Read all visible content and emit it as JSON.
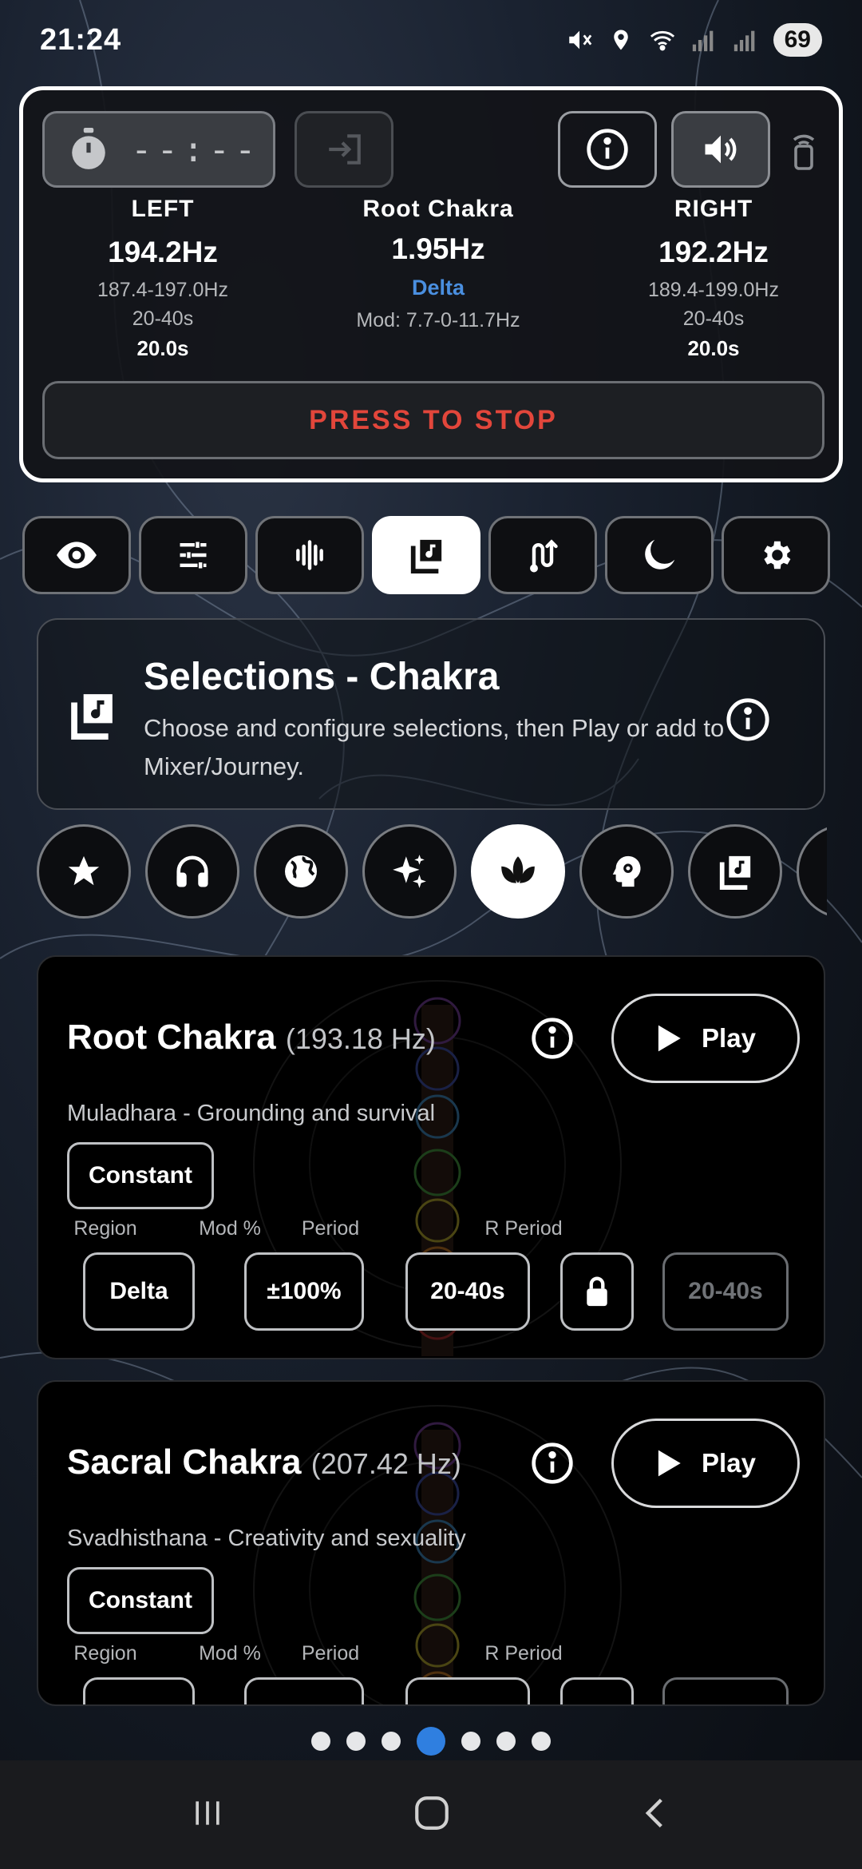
{
  "status_bar": {
    "time": "21:24",
    "battery": "69",
    "icons": [
      "mute-icon",
      "location-icon",
      "wifi-icon",
      "signal-icon",
      "signal-icon"
    ]
  },
  "player": {
    "timer": "--:--",
    "left": {
      "label": "LEFT",
      "hz": "194.2Hz",
      "range": "187.4-197.0Hz",
      "period": "20-40s",
      "current": "20.0s"
    },
    "center": {
      "name": "Root Chakra",
      "hz": "1.95Hz",
      "region": "Delta",
      "mod": "Mod: 7.7-0-11.7Hz"
    },
    "right": {
      "label": "RIGHT",
      "hz": "192.2Hz",
      "range": "189.4-199.0Hz",
      "period": "20-40s",
      "current": "20.0s"
    },
    "stop_label": "PRESS TO STOP"
  },
  "tabs": [
    {
      "icon": "eye-icon"
    },
    {
      "icon": "sliders-icon"
    },
    {
      "icon": "waveform-icon"
    },
    {
      "icon": "music-library-icon",
      "active": true
    },
    {
      "icon": "route-icon"
    },
    {
      "icon": "moon-icon"
    },
    {
      "icon": "gear-icon"
    }
  ],
  "section": {
    "title": "Selections - Chakra",
    "description": "Choose and configure selections, then Play or add to Mixer/Journey."
  },
  "categories": [
    {
      "icon": "star-icon"
    },
    {
      "icon": "headphones-icon"
    },
    {
      "icon": "globe-icon"
    },
    {
      "icon": "sparkles-icon"
    },
    {
      "icon": "lotus-icon",
      "active": true
    },
    {
      "icon": "brain-gear-icon"
    },
    {
      "icon": "music-library-icon"
    },
    {
      "icon": "list-icon"
    }
  ],
  "cards": [
    {
      "name": "Root Chakra",
      "freq": "(193.18 Hz)",
      "play": "Play",
      "subtitle": "Muladhara - Grounding and survival",
      "mode": "Constant",
      "labels": {
        "region": "Region",
        "mod": "Mod %",
        "period": "Period",
        "r_period": "R Period"
      },
      "region": "Delta",
      "mod": "±100%",
      "period": "20-40s",
      "r_period": "20-40s"
    },
    {
      "name": "Sacral Chakra",
      "freq": "(207.42 Hz)",
      "play": "Play",
      "subtitle": "Svadhisthana - Creativity and sexuality",
      "mode": "Constant",
      "labels": {
        "region": "Region",
        "mod": "Mod %",
        "period": "Period",
        "r_period": "R Period"
      }
    }
  ],
  "pager": {
    "count": 7,
    "active_index": 3
  },
  "colors": {
    "stop": "#e2463b",
    "delta": "#4a8fe0",
    "pager_active": "#2f7fe0"
  }
}
